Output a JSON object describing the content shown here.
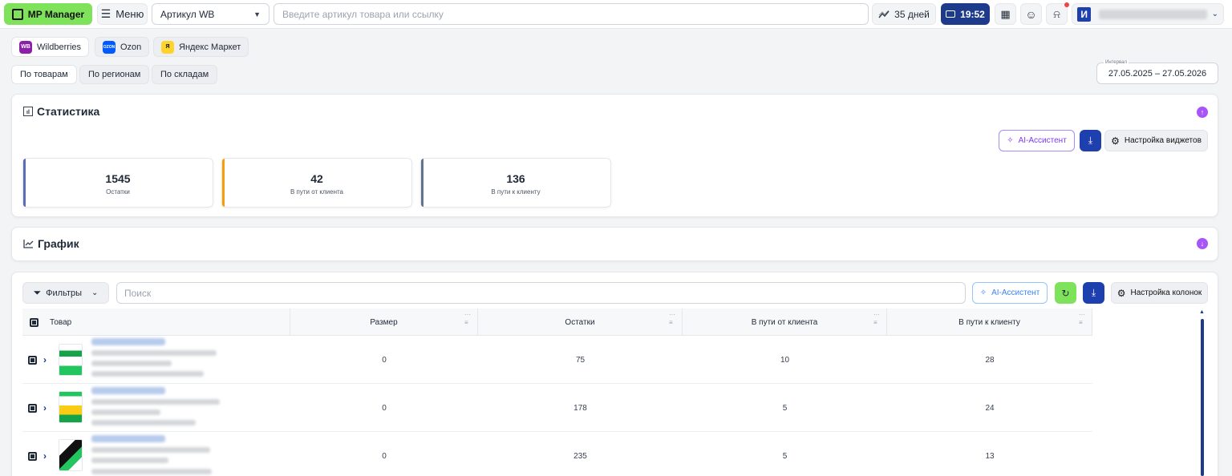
{
  "topbar": {
    "logo_label": "MP Manager",
    "menu_label": "Меню",
    "article_select": "Артикул WB",
    "search_placeholder": "Введите артикул товара или ссылку",
    "days_label": "35 дней",
    "time_label": "19:52",
    "avatar_letter": "И"
  },
  "marketplaces": [
    {
      "label": "Wildberries",
      "icon_text": "WB",
      "color": "#8b1fa9"
    },
    {
      "label": "Ozon",
      "icon_text": "OZON",
      "color": "#005bff"
    },
    {
      "label": "Яндекс Маркет",
      "icon_text": "Я",
      "color": "#fed42b"
    }
  ],
  "views": [
    "По товарам",
    "По регионам",
    "По складам"
  ],
  "interval": {
    "label": "Интервал",
    "value": "27.05.2025 – 27.05.2026"
  },
  "stats_panel": {
    "title": "Статистика",
    "ai_label": "AI-Ассистент",
    "settings_label": "Настройка виджетов",
    "cards": [
      {
        "value": "1545",
        "label": "Остатки",
        "color": "#5b6bb5"
      },
      {
        "value": "42",
        "label": "В пути от клиента",
        "color": "#f59e0b"
      },
      {
        "value": "136",
        "label": "В пути к клиенту",
        "color": "#64748b"
      }
    ]
  },
  "chart_panel": {
    "title": "График"
  },
  "table_panel": {
    "filters_label": "Фильтры",
    "search_placeholder": "Поиск",
    "ai_label": "AI-Ассистент",
    "columns_label": "Настройка колонок",
    "headers": [
      "Товар",
      "Размер",
      "Остатки",
      "В пути от клиента",
      "В пути к клиенту"
    ],
    "rows": [
      {
        "size": "0",
        "stock": "75",
        "from_client": "10",
        "to_client": "28"
      },
      {
        "size": "0",
        "stock": "178",
        "from_client": "5",
        "to_client": "24"
      },
      {
        "size": "0",
        "stock": "235",
        "from_client": "5",
        "to_client": "13"
      }
    ]
  },
  "colors": {
    "accent_green": "#7ee35a",
    "accent_blue": "#1e40af",
    "accent_purple": "#a855f7"
  }
}
